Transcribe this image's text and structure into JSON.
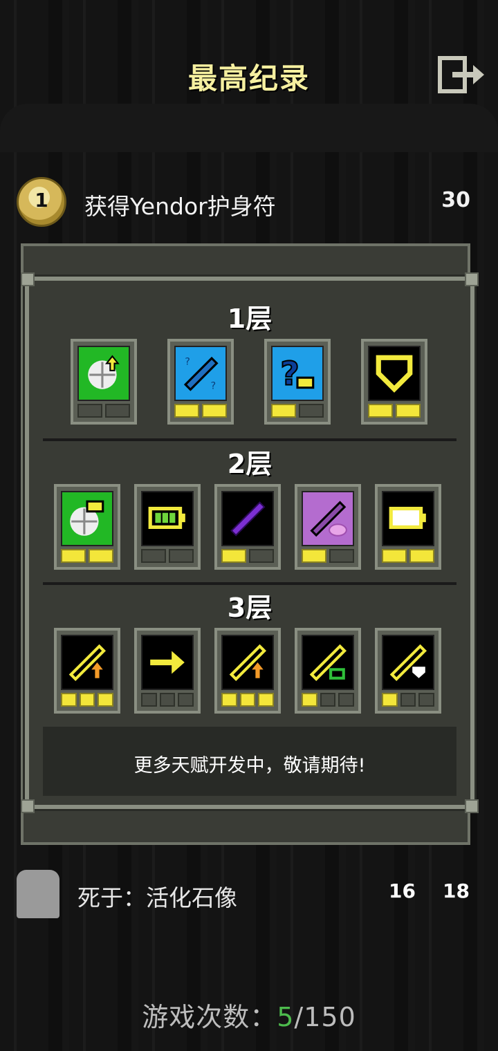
{
  "header": {
    "title": "最高纪录"
  },
  "record": {
    "medal_label": "1",
    "text": "获得Yendor护身符",
    "score": "30"
  },
  "talents": {
    "tiers": [
      {
        "label": "1层"
      },
      {
        "label": "2层"
      },
      {
        "label": "3层"
      }
    ],
    "tier1": [
      {
        "icon": "food-upgrade-icon",
        "bg": "#22b825",
        "points": [
          0,
          0
        ]
      },
      {
        "icon": "wand-identify-icon",
        "bg": "#1f9fe8",
        "points": [
          1,
          1
        ]
      },
      {
        "icon": "unknown-item-icon",
        "bg": "#1f9fe8",
        "points": [
          1,
          0
        ]
      },
      {
        "icon": "armor-shield-icon",
        "bg": "#000000",
        "points": [
          1,
          1
        ]
      }
    ],
    "tier2": [
      {
        "icon": "food-charge-icon",
        "bg": "#22b825",
        "points": [
          1,
          1
        ]
      },
      {
        "icon": "battery-full-icon",
        "bg": "#000000",
        "points": [
          0,
          0
        ]
      },
      {
        "icon": "purple-wand-icon",
        "bg": "#000000",
        "points": [
          1,
          0
        ]
      },
      {
        "icon": "wand-pink-icon",
        "bg": "#b46ccf",
        "points": [
          1,
          0
        ]
      },
      {
        "icon": "battery-empty-icon",
        "bg": "#000000",
        "points": [
          1,
          1
        ]
      }
    ],
    "tier3": [
      {
        "icon": "wand-orange-up-icon",
        "bg": "#000000",
        "points": [
          1,
          1,
          1
        ]
      },
      {
        "icon": "arrow-right-icon",
        "bg": "#000000",
        "points": [
          0,
          0,
          0
        ]
      },
      {
        "icon": "wand-orange-up-icon",
        "bg": "#000000",
        "points": [
          1,
          1,
          1
        ]
      },
      {
        "icon": "wand-green-battery-icon",
        "bg": "#000000",
        "points": [
          1,
          0,
          0
        ]
      },
      {
        "icon": "wand-shield-icon",
        "bg": "#000000",
        "points": [
          1,
          0,
          0
        ]
      }
    ],
    "footer": "更多天赋开发中，敬请期待!"
  },
  "death": {
    "text": "死于：活化石像",
    "depth": "16",
    "level": "18"
  },
  "games": {
    "label": "游戏次数：",
    "current": "5",
    "total": "/150"
  }
}
